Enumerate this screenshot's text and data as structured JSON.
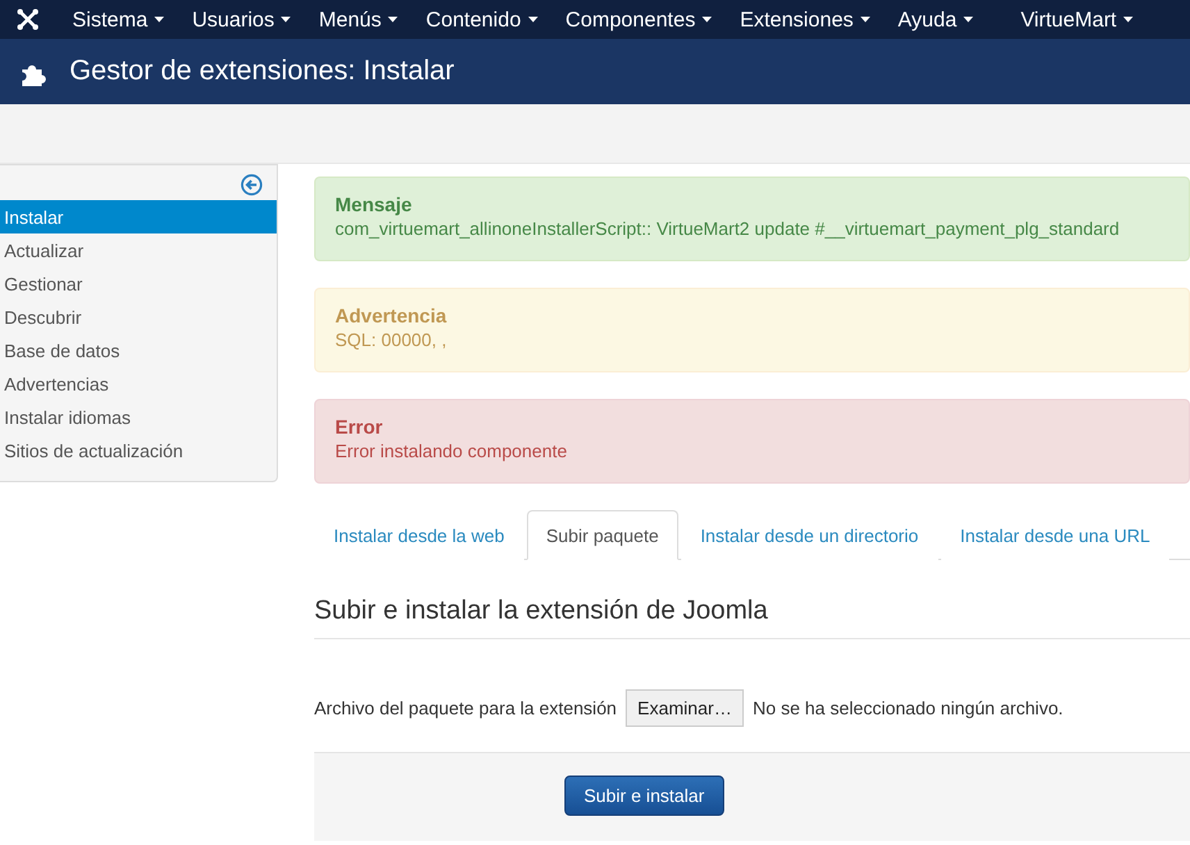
{
  "menu": [
    {
      "label": "Sistema"
    },
    {
      "label": "Usuarios"
    },
    {
      "label": "Menús"
    },
    {
      "label": "Contenido"
    },
    {
      "label": "Componentes"
    },
    {
      "label": "Extensiones"
    },
    {
      "label": "Ayuda"
    },
    {
      "label": "VirtueMart"
    }
  ],
  "page_title": "Gestor de extensiones: Instalar",
  "sidebar": {
    "items": [
      {
        "label": "Instalar",
        "selected": true
      },
      {
        "label": "Actualizar",
        "selected": false
      },
      {
        "label": "Gestionar",
        "selected": false
      },
      {
        "label": "Descubrir",
        "selected": false
      },
      {
        "label": "Base de datos",
        "selected": false
      },
      {
        "label": "Advertencias",
        "selected": false
      },
      {
        "label": "Instalar idiomas",
        "selected": false
      },
      {
        "label": "Sitios de actualización",
        "selected": false
      }
    ]
  },
  "alerts": [
    {
      "kind": "success",
      "heading": "Mensaje",
      "text": "com_virtuemart_allinoneInstallerScript:: VirtueMart2 update #__virtuemart_payment_plg_standard"
    },
    {
      "kind": "warning",
      "heading": "Advertencia",
      "text": "SQL: 00000, ,"
    },
    {
      "kind": "error",
      "heading": "Error",
      "text": "Error instalando componente"
    }
  ],
  "tabs": [
    {
      "label": "Instalar desde la web",
      "selected": false
    },
    {
      "label": "Subir paquete",
      "selected": true
    },
    {
      "label": "Instalar desde un directorio",
      "selected": false
    },
    {
      "label": "Instalar desde una URL",
      "selected": false
    }
  ],
  "section_title": "Subir e instalar la extensión de Joomla",
  "file_field": {
    "label": "Archivo del paquete para la extensión",
    "button": "Examinar…",
    "status": "No se ha seleccionado ningún archivo."
  },
  "submit_button": "Subir e instalar"
}
